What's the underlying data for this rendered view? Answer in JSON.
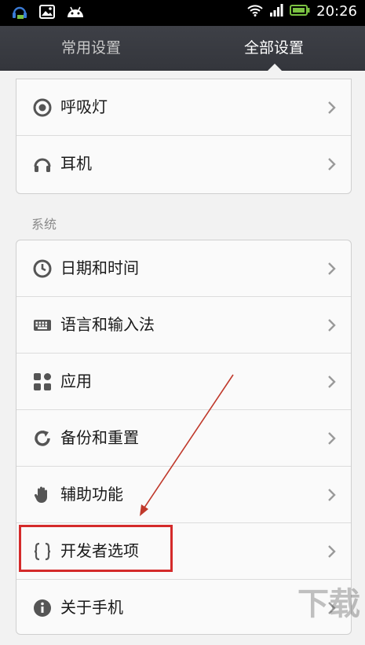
{
  "status_bar": {
    "time": "20:26"
  },
  "tabs": [
    {
      "label": "常用设置",
      "active": false
    },
    {
      "label": "全部设置",
      "active": true
    }
  ],
  "top_card": {
    "items": [
      {
        "label": "呼吸灯",
        "icon": "breathing-light-icon"
      },
      {
        "label": "耳机",
        "icon": "headphone-icon"
      }
    ]
  },
  "system_section": {
    "header": "系统",
    "items": [
      {
        "label": "日期和时间",
        "icon": "clock-icon"
      },
      {
        "label": "语言和输入法",
        "icon": "keyboard-icon"
      },
      {
        "label": "应用",
        "icon": "apps-icon"
      },
      {
        "label": "备份和重置",
        "icon": "backup-icon"
      },
      {
        "label": "辅助功能",
        "icon": "hand-icon"
      },
      {
        "label": "开发者选项",
        "icon": "braces-icon",
        "highlighted": true
      },
      {
        "label": "关于手机",
        "icon": "info-icon"
      }
    ]
  },
  "watermark": "下载",
  "colors": {
    "highlight": "#d42a2a",
    "tabbar": "#3a3c42",
    "background": "#f2f2f2"
  }
}
